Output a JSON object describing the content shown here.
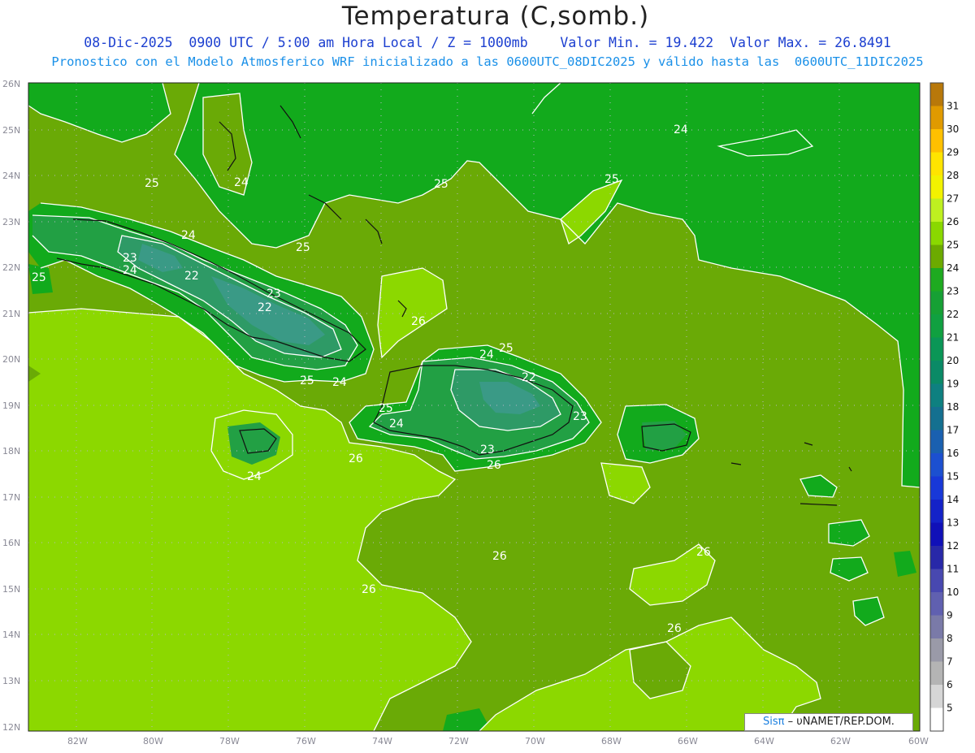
{
  "title": "Temperatura (C,somb.)",
  "subtitle1": "08-Dic-2025  0900 UTC / 5:00 am Hora Local / Z = 1000mb    Valor Min. = 19.422  Valor Max. = 26.8491",
  "subtitle2": "Pronostico con el Modelo Atmosferico WRF inicializado a las 0600UTC_08DIC2025 y válido hasta las  0600UTC_11DIC2025",
  "credit": {
    "brand": "Sisπ",
    "rest": " – υNAMET/REP.DOM."
  },
  "lat_ticks": [
    "26N",
    "25N",
    "24N",
    "23N",
    "22N",
    "21N",
    "20N",
    "19N",
    "18N",
    "17N",
    "16N",
    "15N",
    "14N",
    "13N",
    "12N"
  ],
  "lon_ticks": [
    "82W",
    "80W",
    "78W",
    "76W",
    "74W",
    "72W",
    "70W",
    "68W",
    "66W",
    "64W",
    "62W",
    "60W"
  ],
  "colorbar": {
    "labels": [
      "31",
      "30",
      "29",
      "28",
      "27",
      "26",
      "25",
      "24",
      "23",
      "22",
      "21",
      "20",
      "19",
      "18",
      "17",
      "16",
      "15",
      "14",
      "13",
      "12",
      "11",
      "10",
      "9",
      "8",
      "7",
      "6",
      "5"
    ],
    "colors": [
      "#b8780a",
      "#e09a00",
      "#ffc000",
      "#ffe400",
      "#f2f200",
      "#bef020",
      "#8ad800",
      "#6caa00",
      "#1eaa20",
      "#16a034",
      "#10a040",
      "#0a9656",
      "#0a8a66",
      "#0e8080",
      "#147090",
      "#1a60b0",
      "#1c50d0",
      "#1838d8",
      "#1422c8",
      "#1010b8",
      "#2828a8",
      "#4848b0",
      "#6060b0",
      "#7a7aa8",
      "#9a9aa8",
      "#b4b4b4",
      "#d6d6d6",
      "#ffffff"
    ]
  },
  "map_labels": [
    "24",
    "25",
    "24",
    "25",
    "25",
    "23",
    "24",
    "25",
    "24",
    "22",
    "23",
    "22",
    "25",
    "26",
    "25",
    "24",
    "24",
    "22",
    "25",
    "23",
    "23",
    "25",
    "24",
    "26",
    "24",
    "26",
    "26",
    "26",
    "26",
    "26"
  ],
  "fill_colors": {
    "c24": "#12aa1c",
    "c25": "#6aaa06",
    "c26": "#8cd800",
    "c23": "#22a044",
    "c22": "#2e9a66",
    "c21": "#3a9a86"
  }
}
